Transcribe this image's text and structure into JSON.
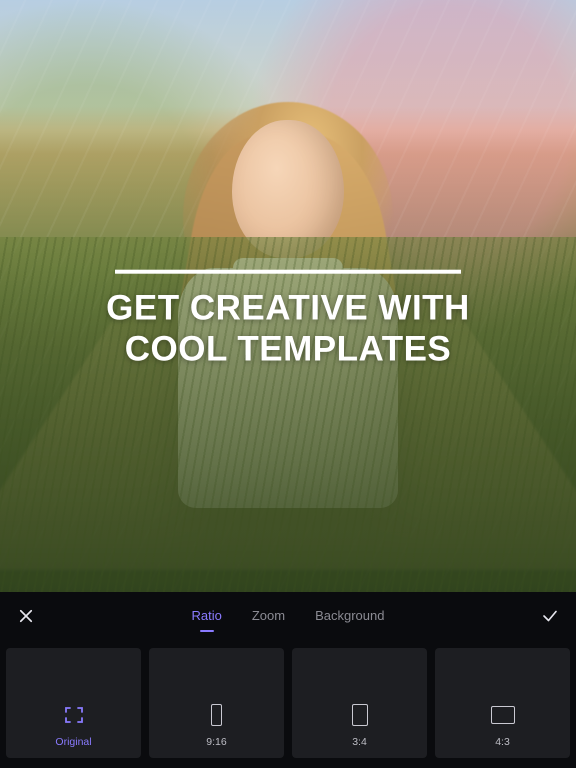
{
  "hero": {
    "headline_line1": "GET CREATIVE WITH",
    "headline_line2": "COOL TEMPLATES"
  },
  "panel": {
    "tabs": {
      "ratio": "Ratio",
      "zoom": "Zoom",
      "background": "Background"
    },
    "ratios": {
      "original": "Original",
      "r916": "9:16",
      "r34": "3:4",
      "r43": "4:3"
    }
  }
}
